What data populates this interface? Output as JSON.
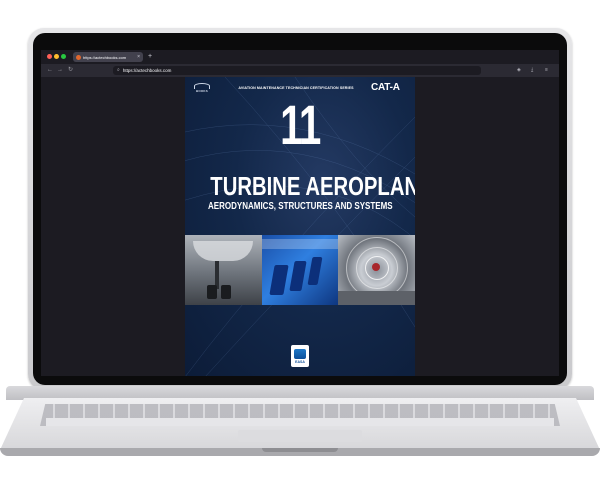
{
  "browser": {
    "tab": {
      "title": "https://actechbooks.com",
      "close_label": "×"
    },
    "new_tab_label": "+",
    "url": "https://actechbooks.com",
    "nav": {
      "back": "←",
      "forward": "→",
      "reload": "↻"
    }
  },
  "book_cover": {
    "publisher": "BOOKS",
    "series": "AVIATION MAINTENANCE TECHNICIAN CERTIFICATION SERIES",
    "category": "CAT-A",
    "module_number": "11",
    "title": "TURBINE AEROPLANE",
    "subtitle": "AERODYNAMICS, STRUCTURES AND SYSTEMS",
    "badge_label": "EASA"
  },
  "colors": {
    "cover_background": "#13284a",
    "browser_chrome": "#2b2a33",
    "tab_active": "#42414d"
  }
}
